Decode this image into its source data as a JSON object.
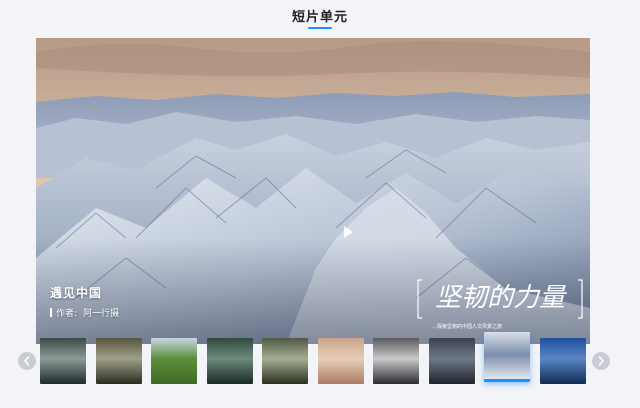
{
  "section": {
    "title": "短片单元"
  },
  "video": {
    "title": "遇见中国",
    "author_label": "作者:",
    "author_name": "阿一行摄",
    "watermark_title": "坚韧的力量",
    "watermark_caption": "…探索坚韧的中国人文风景之旅"
  },
  "thumbnails": [
    {
      "name": "thumb-1",
      "selected": false,
      "colors": [
        "#3b4a48",
        "#8b9b96",
        "#1f2a2a"
      ]
    },
    {
      "name": "thumb-2",
      "selected": false,
      "colors": [
        "#57553f",
        "#9fa08a",
        "#2c2b22"
      ]
    },
    {
      "name": "thumb-3",
      "selected": false,
      "colors": [
        "#c9d6e6",
        "#5d8f3a",
        "#3f6a26"
      ]
    },
    {
      "name": "thumb-4",
      "selected": false,
      "colors": [
        "#2f4940",
        "#6e8a7c",
        "#1a2a25"
      ]
    },
    {
      "name": "thumb-5",
      "selected": false,
      "colors": [
        "#4f5a44",
        "#a6ad92",
        "#2a2f22"
      ]
    },
    {
      "name": "thumb-6",
      "selected": false,
      "colors": [
        "#c9a48a",
        "#e8cdb9",
        "#a97d62"
      ]
    },
    {
      "name": "thumb-7",
      "selected": false,
      "colors": [
        "#5a5a5e",
        "#c9c9cc",
        "#2c2c30"
      ]
    },
    {
      "name": "thumb-8",
      "selected": false,
      "colors": [
        "#3b4350",
        "#6e7888",
        "#1f242c"
      ]
    },
    {
      "name": "thumb-9",
      "selected": true,
      "colors": [
        "#d9dfe8",
        "#7d8fae",
        "#eef2f7"
      ]
    },
    {
      "name": "thumb-10",
      "selected": false,
      "colors": [
        "#1f4f9c",
        "#5b86c4",
        "#0f2a55"
      ]
    }
  ],
  "colors": {
    "accent": "#1e90ff",
    "arrow_bg": "#c9ccd3"
  },
  "icons": {
    "play": "play-icon",
    "prev": "chevron-left-icon",
    "next": "chevron-right-icon"
  }
}
